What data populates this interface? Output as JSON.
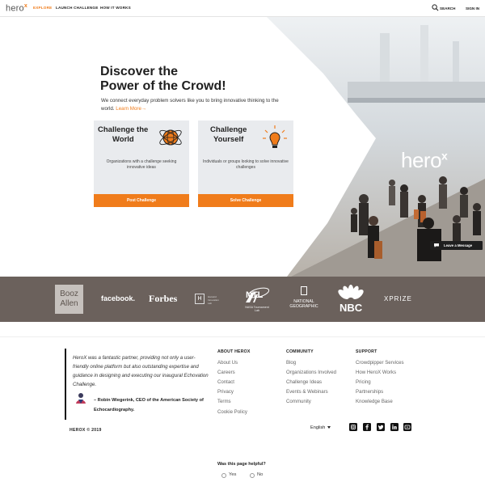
{
  "nav": {
    "logo_text": "hero",
    "logo_mark": "x",
    "links": [
      {
        "label": "EXPLORE",
        "active": true
      },
      {
        "label": "LAUNCH CHALLENGE",
        "active": false
      },
      {
        "label": "HOW IT WORKS",
        "active": false
      }
    ],
    "search_label": "SEARCH",
    "sign_in_label": "SIGN IN",
    "accent": "#f07c1b"
  },
  "hero": {
    "title_line1": "Discover the",
    "title_line2": "Power of the Crowd!",
    "subtitle": "We connect everyday problem solvers like you to bring innovative thinking to the world.",
    "learn_more": "Learn More→",
    "brand_text": "hero",
    "brand_mark": "x",
    "cards": [
      {
        "title_line1": "Challenge the",
        "title_line2": "World",
        "description": "Organizations with a challenge seeking innovative ideas",
        "button": "Post Challenge",
        "icon": "globe-icon"
      },
      {
        "title_line1": "Challenge",
        "title_line2": "Yourself",
        "description": "Individuals or groups looking to solve innovative challenges",
        "button": "Solve Challenge",
        "icon": "lightbulb-icon"
      }
    ],
    "leave_message": "Leave a Message"
  },
  "partners": {
    "booz_line1": "Booz",
    "booz_line2": "Allen",
    "facebook": "facebook.",
    "forbes": "Forbes",
    "h_mark": "H",
    "h_text": "Harvard Innovation Lab",
    "ntl_mark": "NTL",
    "ntl_text": "NASA Tournament Lab",
    "natgeo": "NATIONAL GEOGRAPHIC",
    "nbc": "NBC",
    "xprize": "XPRIZE"
  },
  "footer": {
    "quote": "HeroX was a fantastic partner, providing not only a user-friendly online platform but also outstanding expertise and guidance in designing and executing our inaugural Echovation Challenge.",
    "author": "– Robin Wiegerink, CEO of the American Society of Echocardiography.",
    "columns": [
      {
        "title": "ABOUT HEROX",
        "links": [
          "About Us",
          "Careers",
          "Contact",
          "Privacy",
          "Terms",
          "Cookie Policy"
        ]
      },
      {
        "title": "COMMUNITY",
        "links": [
          "Blog",
          "Organizations Involved",
          "Challenge Ideas",
          "Events & Webinars",
          "Community"
        ]
      },
      {
        "title": "SUPPORT",
        "links": [
          "Crowdpipper Services",
          "How HeroX Works",
          "Pricing",
          "Partnerships",
          "Knowledge Base"
        ]
      }
    ],
    "copyright": "HEROX © 2019",
    "language": "English",
    "social": [
      "instagram-icon",
      "facebook-icon",
      "twitter-icon",
      "linkedin-icon",
      "youtube-icon"
    ],
    "helpful_question": "Was this page helpful?",
    "yes": "Yes",
    "no": "No"
  }
}
